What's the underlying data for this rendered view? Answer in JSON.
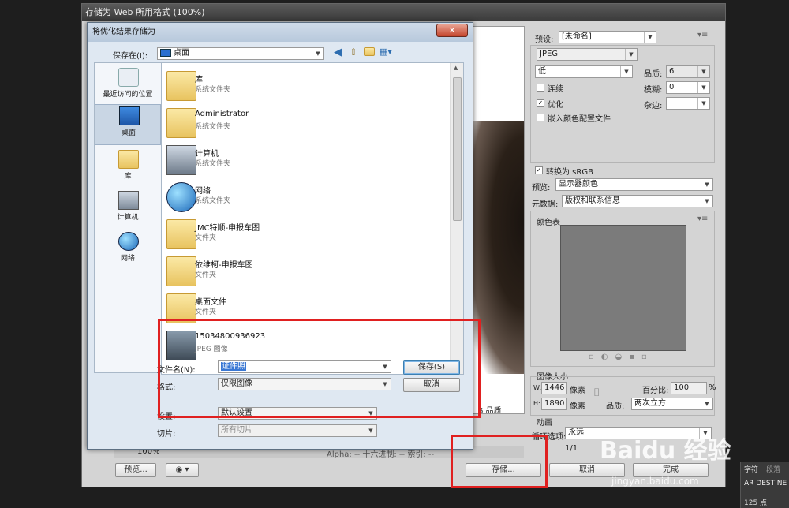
{
  "sfw": {
    "title": "存储为 Web 所用格式 (100%)",
    "preset_label": "预设:",
    "preset_value": "[未命名]",
    "format_value": "JPEG",
    "quality_level": "低",
    "quality_label": "品质:",
    "quality_value": "6",
    "progressive_label": "连续",
    "blur_label": "模糊:",
    "blur_value": "0",
    "optimized_label": "优化",
    "matte_label": "杂边:",
    "embed_profile_label": "嵌入颜色配置文件",
    "convert_srgb_label": "转换为 sRGB",
    "preview_label": "预览:",
    "preview_value": "显示器颜色",
    "metadata_label": "元数据:",
    "metadata_value": "版权和联系信息",
    "color_table_label": "颜色表",
    "image_size_label": "图像大小",
    "w_label": "W:",
    "w_value": "1446",
    "h_label": "H:",
    "h_value": "1890",
    "px_label": "像素",
    "percent_label": "百分比:",
    "percent_value": "100",
    "percent_sign": "%",
    "quality2_label": "品质:",
    "quality2_value": "两次立方",
    "animation_label": "动画",
    "loop_label": "循环选项:",
    "loop_value": "永远",
    "frame_counter": "1/1",
    "quality_status": "6 品质",
    "preview_button": "预览...",
    "save_button": "存储...",
    "cancel_button": "取消",
    "done_button": "完成",
    "status_text": "Alpha:  --  十六进制:  --    索引:  --",
    "zoom_value": "100%"
  },
  "dialog": {
    "title": "将优化结果存储为",
    "save_in_label": "保存在(I):",
    "save_in_value": "桌面",
    "places": [
      {
        "label": "最近访问的位置"
      },
      {
        "label": "桌面"
      },
      {
        "label": "库"
      },
      {
        "label": "计算机"
      },
      {
        "label": "网络"
      }
    ],
    "files": [
      {
        "name": "库",
        "desc": "系统文件夹"
      },
      {
        "name": "Administrator",
        "desc": "系统文件夹"
      },
      {
        "name": "计算机",
        "desc": "系统文件夹"
      },
      {
        "name": "网络",
        "desc": "系统文件夹"
      },
      {
        "name": "JMC特顺-申报车图",
        "desc": "文件夹"
      },
      {
        "name": "依维柯-申报车图",
        "desc": "文件夹"
      },
      {
        "name": "桌面文件",
        "desc": "文件夹"
      },
      {
        "name": "15034800936923",
        "desc": "JPEG 图像"
      }
    ],
    "filename_label": "文件名(N):",
    "filename_value": "证件照",
    "format_label": "格式:",
    "format_value": "仅限图像",
    "settings_label": "设置:",
    "settings_value": "默认设置",
    "slices_label": "切片:",
    "slices_value": "所有切片",
    "save_button": "保存(S)",
    "cancel_button": "取消"
  },
  "side": {
    "tab1": "字符",
    "tab2": "段落",
    "font": "AR DESTINE",
    "size": "125 点"
  },
  "watermark": {
    "brand": "Baidu 经验",
    "url": "jingyan.baidu.com"
  }
}
